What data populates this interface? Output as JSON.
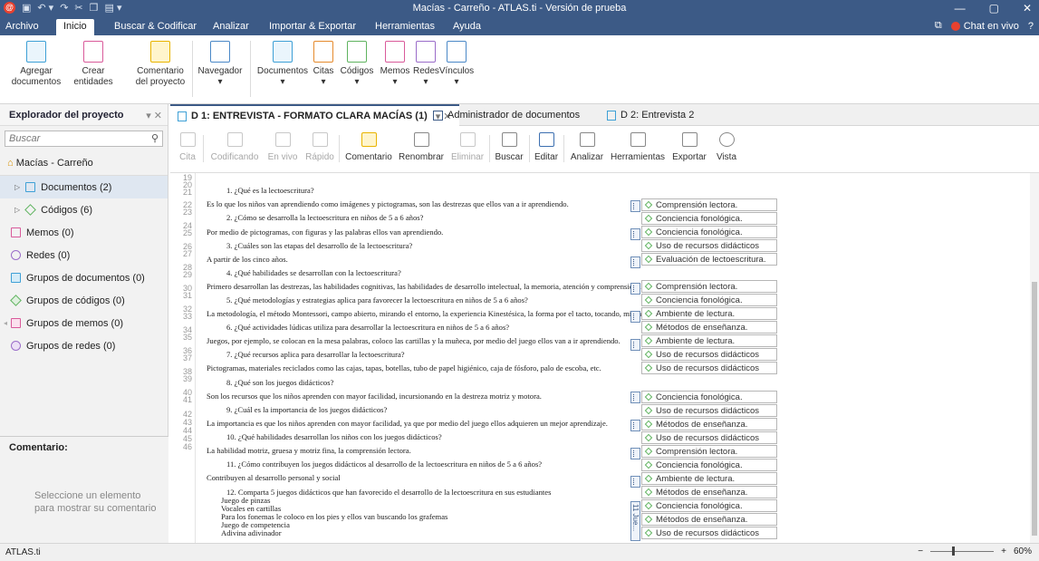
{
  "window": {
    "title": "Macías - Carreño - ATLAS.ti - Versión de prueba",
    "logo": "@",
    "controls": [
      "—",
      "▢",
      "✕"
    ]
  },
  "menu": {
    "items": [
      "Archivo",
      "Inicio",
      "Buscar & Codificar",
      "Analizar",
      "Importar & Exportar",
      "Herramientas",
      "Ayuda"
    ],
    "chat": "Chat en vivo",
    "help": "?"
  },
  "ribbon": {
    "buttons": [
      {
        "label": "Agregar\ndocumentos",
        "caret": "▾"
      },
      {
        "label": "Crear\nentidades",
        "caret": "▾"
      },
      {
        "label": "Comentario\ndel proyecto"
      },
      {
        "label": "Navegador",
        "caret": "▾"
      },
      {
        "label": "Documentos",
        "caret": "▾"
      },
      {
        "label": "Citas",
        "caret": "▾"
      },
      {
        "label": "Códigos",
        "caret": "▾"
      },
      {
        "label": "Memos",
        "caret": "▾"
      },
      {
        "label": "Redes",
        "caret": "▾"
      },
      {
        "label": "Vínculos",
        "caret": "▾"
      }
    ]
  },
  "explorer": {
    "title": "Explorador del proyecto",
    "search_placeholder": "Buscar",
    "project": "Macías - Carreño",
    "items": [
      {
        "label": "Documentos (2)"
      },
      {
        "label": "Códigos (6)"
      },
      {
        "label": "Memos (0)"
      },
      {
        "label": "Redes (0)"
      },
      {
        "label": "Grupos de documentos (0)"
      },
      {
        "label": "Grupos de códigos (0)"
      },
      {
        "label": "Grupos de memos (0)"
      },
      {
        "label": "Grupos de redes (0)"
      }
    ],
    "comment_title": "Comentario:",
    "comment_hint": "Seleccione un elemento para mostrar su comentario"
  },
  "tabs": [
    {
      "label": "D 1: ENTREVISTA - FORMATO CLARA MACÍAS (1)"
    },
    {
      "label": "Administrador de documentos"
    },
    {
      "label": "D 2: Entrevista 2"
    }
  ],
  "doc_toolbar": [
    {
      "label": "Cita"
    },
    {
      "label": "Codificando"
    },
    {
      "label": "En vivo"
    },
    {
      "label": "Rápido"
    },
    {
      "label": "Comentario"
    },
    {
      "label": "Renombrar"
    },
    {
      "label": "Eliminar"
    },
    {
      "label": "Buscar"
    },
    {
      "label": "Editar"
    },
    {
      "label": "Analizar"
    },
    {
      "label": "Herramientas"
    },
    {
      "label": "Exportar"
    },
    {
      "label": "Vista"
    }
  ],
  "line_numbers": [
    "19",
    "20",
    "21",
    "22",
    "23",
    "24",
    "25",
    "26",
    "27",
    "28",
    "29",
    "30",
    "31",
    "32",
    "33",
    "34",
    "35",
    "36",
    "37",
    "38",
    "39",
    "40",
    "41",
    "42",
    "43",
    "44",
    "45",
    "46"
  ],
  "document_lines": [
    "1.   ¿Qué es la lectoescritura?",
    "Es lo que los niños van aprendiendo como imágenes y pictogramas, son las destrezas que ellos van a ir aprendiendo.",
    "2.   ¿Cómo se desarrolla la lectoescritura en niños de 5 a 6 años?",
    "Por medio de pictogramas, con figuras y las palabras ellos van aprendiendo.",
    "3.   ¿Cuáles son las etapas del desarrollo de la lectoescritura?",
    "A partir de los cinco años.",
    "4.   ¿Qué habilidades se desarrollan con la lectoescritura?",
    "Primero desarrollan las destrezas, las habilidades cognitivas, las habilidades de desarrollo intelectual, la memoria, atención y comprensión lectora.",
    "5.   ¿Qué metodologías y estrategias aplica para favorecer la lectoescritura en niños de 5 a 6 años?",
    "La metodología, el método Montessori, campo abierto, mirando el entorno, la experiencia Kinestésica, la forma por el tacto, tocando, mirando.",
    "6.   ¿Qué actividades lúdicas utiliza para desarrollar la lectoescritura en niños de 5 a 6 años?",
    "Juegos, por ejemplo, se colocan en la mesa palabras, coloco las cartillas y la muñeca, por medio del juego ellos van a ir aprendiendo.",
    "7.   ¿Qué recursos aplica para desarrollar la lectoescritura?",
    "Pictogramas, materiales reciclados como las cajas, tapas, botellas, tubo de papel higiénico, caja de fósforo, palo de escoba, etc.",
    "8.   ¿Qué son los juegos didácticos?",
    "Son los recursos que los niños aprenden con mayor facilidad, incursionando en la destreza motriz y motora.",
    "9.   ¿Cuál es la importancia de los juegos didácticos?",
    "La importancia es que los niños aprenden con mayor facilidad, ya que por medio del juego ellos adquieren un mejor aprendizaje.",
    "10.  ¿Qué habilidades desarrollan los niños con los juegos didácticos?",
    "La habilidad motriz, gruesa y motriz fina, la comprensión lectora.",
    "11.  ¿Cómo contribuyen los juegos didácticos al desarrollo de la lectoescritura en niños de 5 a 6 años?",
    "Contribuyen al desarrollo personal y social",
    "12.  Comparta 5 juegos didácticos que han favorecido el desarrollo de la lectoescritura en sus estudiantes",
    "Juego de pinzas",
    "Vocales en cartillas",
    "Para los fonemas le coloco en los pies y ellos van buscando los grafemas",
    "Juego de competencia",
    "Adivina adivinador"
  ],
  "codes": [
    "Comprensión lectora.",
    "Conciencia fonológica.",
    "Conciencia fonológica.",
    "Uso de recursos didácticos",
    "Evaluación de lectoescritura.",
    "Comprensión lectora.",
    "Conciencia fonológica.",
    "Ambiente de lectura.",
    "Métodos de enseñanza.",
    "Ambiente de lectura.",
    "Uso de recursos didácticos",
    "Uso de recursos didácticos",
    "Conciencia fonológica.",
    "Uso de recursos didácticos",
    "Métodos de enseñanza.",
    "Uso de recursos didácticos",
    "Comprensión lectora.",
    "Conciencia fonológica.",
    "Ambiente de lectura.",
    "Métodos de enseñanza.",
    "Conciencia fonológica.",
    "Métodos de enseñanza.",
    "Uso de recursos didácticos"
  ],
  "quote_label": "11 Jue...",
  "status": {
    "app": "ATLAS.ti",
    "zoom": "60%",
    "minus": "−",
    "plus": "+"
  },
  "colors": {
    "titlebar": "#3c5a86",
    "accent_doc": "#3ea0d6",
    "accent_code": "#5fb35f",
    "accent_memo": "#d95a9a",
    "accent_net": "#9a6cc9"
  }
}
